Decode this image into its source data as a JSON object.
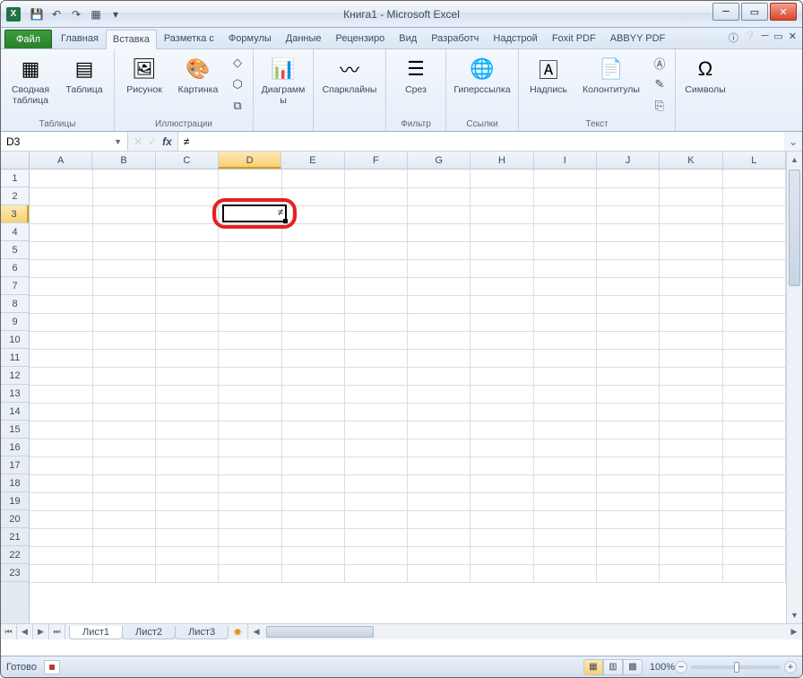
{
  "window": {
    "title": "Книга1 - Microsoft Excel"
  },
  "qat": {
    "save": "💾",
    "undo": "↶",
    "redo": "↷",
    "custom": "▦"
  },
  "tabs": {
    "file": "Файл",
    "items": [
      "Главная",
      "Вставка",
      "Разметка с",
      "Формулы",
      "Данные",
      "Рецензиро",
      "Вид",
      "Разработч",
      "Надстрой",
      "Foxit PDF",
      "ABBYY PDF"
    ],
    "active_index": 1
  },
  "ribbon": {
    "groups": {
      "tables": {
        "label": "Таблицы",
        "pivot": "Сводная таблица",
        "table": "Таблица"
      },
      "illustrations": {
        "label": "Иллюстрации",
        "picture": "Рисунок",
        "clipart": "Картинка"
      },
      "charts": {
        "label": "",
        "charts": "Диаграммы"
      },
      "sparklines": {
        "label": "",
        "spark": "Спарклайны"
      },
      "filter": {
        "label": "Фильтр",
        "slicer": "Срез"
      },
      "links": {
        "label": "Ссылки",
        "hyperlink": "Гиперссылка"
      },
      "text": {
        "label": "Текст",
        "textbox": "Надпись",
        "headerfooter": "Колонтитулы"
      },
      "symbols": {
        "label": "",
        "symbols": "Символы"
      }
    }
  },
  "namebox": {
    "value": "D3"
  },
  "formula": {
    "value": "≠"
  },
  "columns": [
    "A",
    "B",
    "C",
    "D",
    "E",
    "F",
    "G",
    "H",
    "I",
    "J",
    "K",
    "L"
  ],
  "rows": [
    "1",
    "2",
    "3",
    "4",
    "5",
    "6",
    "7",
    "8",
    "9",
    "10",
    "11",
    "12",
    "13",
    "14",
    "15",
    "16",
    "17",
    "18",
    "19",
    "20",
    "21",
    "22",
    "23"
  ],
  "selected": {
    "col": "D",
    "row": "3",
    "col_index": 3,
    "row_index": 2,
    "value": "≠"
  },
  "sheets": {
    "items": [
      "Лист1",
      "Лист2",
      "Лист3"
    ],
    "active_index": 0
  },
  "status": {
    "ready": "Готово",
    "zoom": "100%"
  }
}
